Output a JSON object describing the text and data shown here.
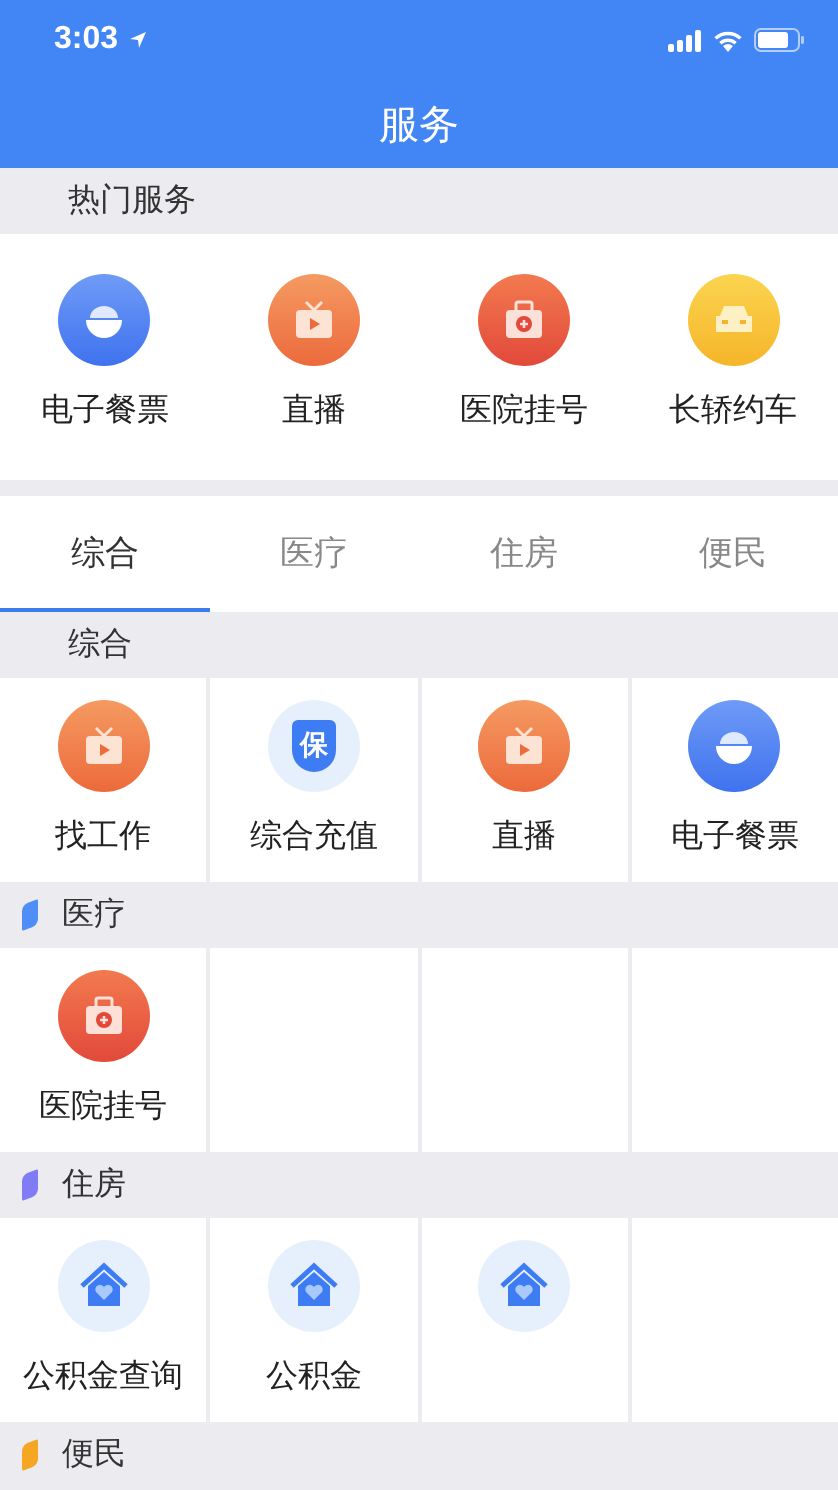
{
  "status_bar": {
    "time": "3:03"
  },
  "header": {
    "title": "服务"
  },
  "hot": {
    "title": "热门服务",
    "items": [
      {
        "label": "电子餐票",
        "kind": "bowl"
      },
      {
        "label": "直播",
        "kind": "tv"
      },
      {
        "label": "医院挂号",
        "kind": "medkit"
      },
      {
        "label": "长轿约车",
        "kind": "car"
      }
    ]
  },
  "tabs": [
    {
      "label": "综合",
      "selected": true
    },
    {
      "label": "医疗",
      "selected": false
    },
    {
      "label": "住房",
      "selected": false
    },
    {
      "label": "便民",
      "selected": false
    }
  ],
  "sections": [
    {
      "title": "综合",
      "items": [
        {
          "label": "找工作",
          "kind": "tv"
        },
        {
          "label": "综合充值",
          "kind": "shield",
          "glyph": "保"
        },
        {
          "label": "直播",
          "kind": "tv"
        },
        {
          "label": "电子餐票",
          "kind": "bowl"
        }
      ]
    },
    {
      "title": "医疗",
      "color": "#4f8ef7",
      "items": [
        {
          "label": "医院挂号",
          "kind": "medkit"
        }
      ]
    },
    {
      "title": "住房",
      "color": "#7f7cf5",
      "items": [
        {
          "label": "公积金查询",
          "kind": "house"
        },
        {
          "label": "公积金",
          "kind": "house"
        },
        {
          "kind": "house"
        }
      ]
    },
    {
      "title": "便民",
      "color": "#f5a623"
    }
  ]
}
